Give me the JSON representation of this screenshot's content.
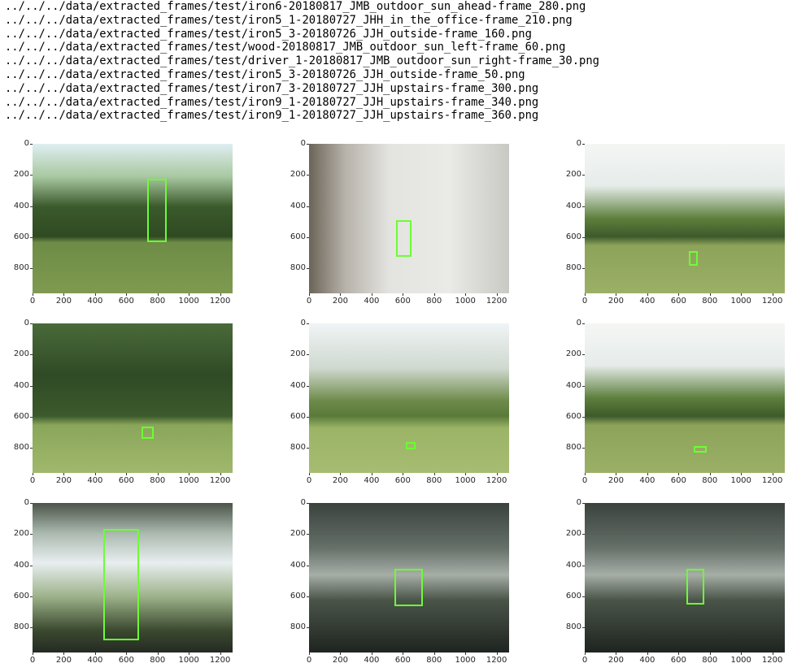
{
  "output_lines": [
    "../../../data/extracted_frames/test/iron6-20180817_JMB_outdoor_sun_ahead-frame_280.png",
    "../../../data/extracted_frames/test/iron5_1-20180727_JHH_in_the_office-frame_210.png",
    "../../../data/extracted_frames/test/iron5_3-20180726_JJH_outside-frame_160.png",
    "../../../data/extracted_frames/test/wood-20180817_JMB_outdoor_sun_left-frame_60.png",
    "../../../data/extracted_frames/test/driver_1-20180817_JMB_outdoor_sun_right-frame_30.png",
    "../../../data/extracted_frames/test/iron5_3-20180726_JJH_outside-frame_50.png",
    "../../../data/extracted_frames/test/iron7_3-20180727_JJH_upstairs-frame_300.png",
    "../../../data/extracted_frames/test/iron9_1-20180727_JJH_upstairs-frame_340.png",
    "../../../data/extracted_frames/test/iron9_1-20180727_JJH_upstairs-frame_360.png"
  ],
  "axes": {
    "x_ticks": [
      "0",
      "200",
      "400",
      "600",
      "800",
      "1000",
      "1200"
    ],
    "y_ticks": [
      "0",
      "200",
      "400",
      "600",
      "800"
    ],
    "x_range": [
      0,
      1280
    ],
    "y_range": [
      0,
      960
    ]
  },
  "colors": {
    "bbox": "#6dfc36"
  },
  "panels": [
    {
      "scene": "outdoor-ahead",
      "box": [
        735,
        225,
        860,
        630
      ]
    },
    {
      "scene": "office",
      "box": [
        555,
        490,
        655,
        725
      ]
    },
    {
      "scene": "outdoor-lawn",
      "box": [
        665,
        690,
        725,
        780
      ]
    },
    {
      "scene": "outdoor-trees",
      "box": [
        695,
        665,
        775,
        740
      ]
    },
    {
      "scene": "outdoor-bright",
      "box": [
        620,
        760,
        680,
        810
      ]
    },
    {
      "scene": "outdoor-lawn",
      "box": [
        695,
        790,
        780,
        830
      ]
    },
    {
      "scene": "corridor-bright",
      "box": [
        455,
        165,
        680,
        880
      ]
    },
    {
      "scene": "hall-dark",
      "box": [
        545,
        420,
        730,
        665
      ]
    },
    {
      "scene": "hall-dark",
      "box": [
        650,
        425,
        765,
        650
      ]
    }
  ]
}
